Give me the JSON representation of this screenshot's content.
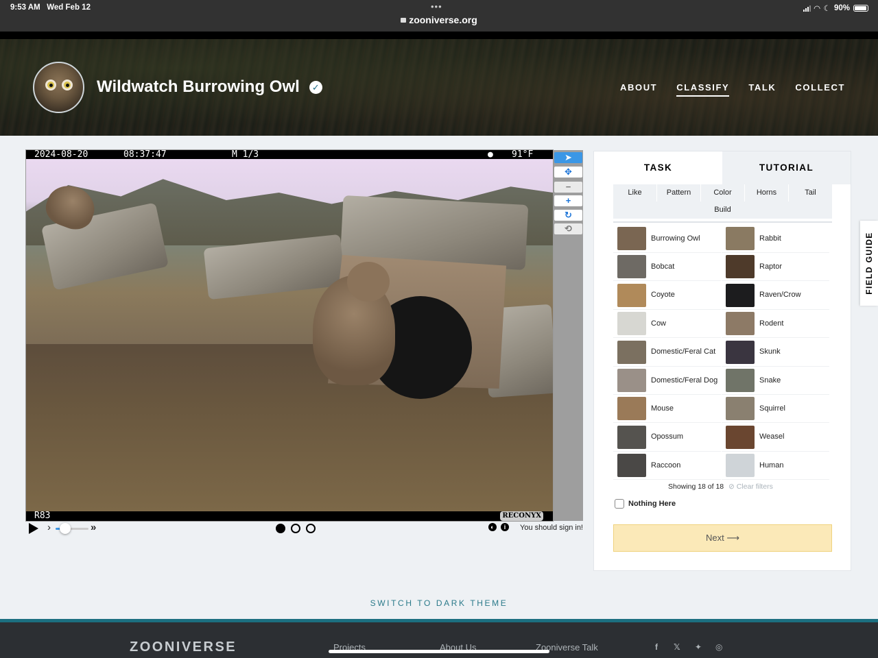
{
  "status_bar": {
    "time": "9:53 AM",
    "date": "Wed Feb 12",
    "url": "zooniverse.org",
    "battery": "90%"
  },
  "project": {
    "title": "Wildwatch Burrowing Owl",
    "verified_icon": "check-circle-icon"
  },
  "nav": {
    "items": [
      {
        "label": "ABOUT",
        "active": false
      },
      {
        "label": "CLASSIFY",
        "active": true
      },
      {
        "label": "TALK",
        "active": false
      },
      {
        "label": "COLLECT",
        "active": false
      }
    ]
  },
  "camera": {
    "date": "2024-08-20",
    "time": "08:37:47",
    "mode": "M 1/3",
    "moon": "●",
    "temp": "91°F",
    "id": "R83",
    "brand": "RECONYX"
  },
  "tools": [
    "pointer-icon",
    "pan-icon",
    "zoom-out-icon",
    "zoom-in-icon",
    "rotate-icon",
    "reset-icon"
  ],
  "controls": {
    "frames": 3,
    "current_frame": 1,
    "signin": "You should sign in!"
  },
  "tabs": {
    "task": "TASK",
    "tutorial": "TUTORIAL"
  },
  "filters": [
    "Like",
    "Pattern",
    "Color",
    "Horns",
    "Tail",
    "Build"
  ],
  "choices": [
    {
      "label": "Burrowing Owl",
      "color": "#7a6652"
    },
    {
      "label": "Rabbit",
      "color": "#8a7a62"
    },
    {
      "label": "Bobcat",
      "color": "#6e6a64"
    },
    {
      "label": "Raptor",
      "color": "#4e3a2a"
    },
    {
      "label": "Coyote",
      "color": "#b08a5a"
    },
    {
      "label": "Raven/Crow",
      "color": "#1c1c1e"
    },
    {
      "label": "Cow",
      "color": "#d7d7d2"
    },
    {
      "label": "Rodent",
      "color": "#8d7a66"
    },
    {
      "label": "Domestic/Feral Cat",
      "color": "#7b7060"
    },
    {
      "label": "Skunk",
      "color": "#3a3540"
    },
    {
      "label": "Domestic/Feral Dog",
      "color": "#9a9088"
    },
    {
      "label": "Snake",
      "color": "#707468"
    },
    {
      "label": "Mouse",
      "color": "#9a7a58"
    },
    {
      "label": "Squirrel",
      "color": "#8a8070"
    },
    {
      "label": "Opossum",
      "color": "#55534f"
    },
    {
      "label": "Weasel",
      "color": "#6a4630"
    },
    {
      "label": "Raccoon",
      "color": "#4a4846"
    },
    {
      "label": "Human",
      "color": "#cfd4d8"
    }
  ],
  "showing": "Showing 18 of 18",
  "clear_filters": "Clear filters",
  "nothing_here": "Nothing Here",
  "next_label": "Next ⟶",
  "field_guide": "FIELD GUIDE",
  "theme_switch": "SWITCH TO DARK THEME",
  "footer": {
    "logo": "ZOONIVERSE",
    "links": [
      "Projects",
      "About Us",
      "Zooniverse Talk"
    ],
    "social": [
      "facebook-icon",
      "twitter-icon",
      "bluesky-icon",
      "instagram-icon"
    ]
  }
}
